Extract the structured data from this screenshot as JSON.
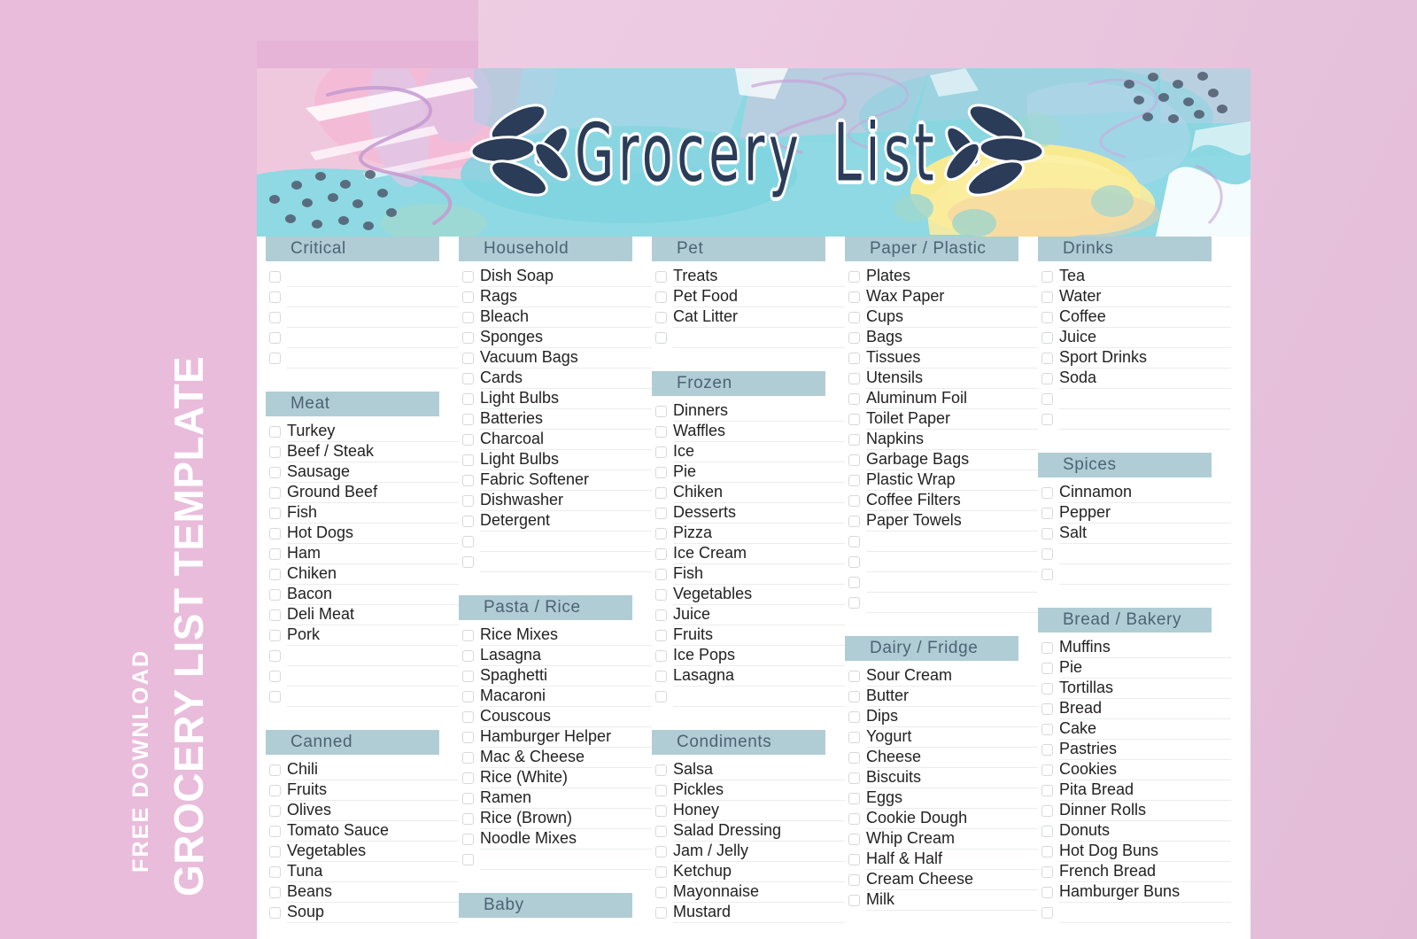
{
  "sidebar": {
    "title": "GROCERY LIST TEMPLATE",
    "subtitle": "FREE DOWNLOAD"
  },
  "banner": {
    "title_words": [
      "Grocery",
      "List"
    ],
    "title": "GROCERY LIST",
    "leaf_icon_left": "leaf-sprig-icon",
    "leaf_icon_right": "leaf-sprig-icon"
  },
  "colors": {
    "section_header_bg": "#b0cdd5",
    "section_header_text": "#4d6274",
    "page_bg_pink": "#e9c4dd",
    "sidebar_pink": "#e5b4d7",
    "banner_teal": "#8ed9e3",
    "banner_pink": "#f6c9de",
    "banner_yellow": "#f7e98f",
    "banner_navy": "#2b3c58",
    "item_rule": "#ebecee",
    "checkbox_border": "#d6d8da"
  },
  "columns": [
    {
      "name": "column-1",
      "sections": [
        {
          "title": "Critical",
          "items": [],
          "blank_rows": 5
        },
        {
          "title": "Meat",
          "items": [
            "Turkey",
            "Beef / Steak",
            "Sausage",
            "Ground Beef",
            "Fish",
            "Hot Dogs",
            "Ham",
            "Chiken",
            "Bacon",
            "Deli Meat",
            "Pork"
          ],
          "blank_rows": 3
        },
        {
          "title": "Canned",
          "items": [
            "Chili",
            "Fruits",
            "Olives",
            "Tomato Sauce",
            "Vegetables",
            "Tuna",
            "Beans",
            "Soup"
          ],
          "blank_rows": 0
        }
      ]
    },
    {
      "name": "column-2",
      "sections": [
        {
          "title": "Household",
          "items": [
            "Dish Soap",
            "Rags",
            "Bleach",
            "Sponges",
            "Vacuum Bags",
            "Cards",
            "Light Bulbs",
            "Batteries",
            "Charcoal",
            "Light Bulbs",
            "Fabric Softener",
            "Dishwasher",
            "Detergent"
          ],
          "blank_rows": 2
        },
        {
          "title": "Pasta / Rice",
          "items": [
            "Rice Mixes",
            "Lasagna",
            "Spaghetti",
            "Macaroni",
            "Couscous",
            "Hamburger Helper",
            "Mac & Cheese",
            "Rice (White)",
            "Ramen",
            "Rice (Brown)",
            "Noodle Mixes"
          ],
          "blank_rows": 1
        },
        {
          "title": "Baby",
          "items": [],
          "blank_rows": 0
        }
      ]
    },
    {
      "name": "column-3",
      "sections": [
        {
          "title": "Pet",
          "items": [
            "Treats",
            "Pet Food",
            "Cat Litter"
          ],
          "blank_rows": 1
        },
        {
          "title": "Frozen",
          "items": [
            "Dinners",
            "Waffles",
            "Ice",
            "Pie",
            "Chiken",
            "Desserts",
            "Pizza",
            "Ice Cream",
            "Fish",
            "Vegetables",
            "Juice",
            "Fruits",
            "Ice Pops",
            "Lasagna"
          ],
          "blank_rows": 1
        },
        {
          "title": "Condiments",
          "items": [
            "Salsa",
            "Pickles",
            "Honey",
            "Salad Dressing",
            "Jam / Jelly",
            "Ketchup",
            "Mayonnaise",
            "Mustard"
          ],
          "blank_rows": 0
        }
      ]
    },
    {
      "name": "column-4",
      "sections": [
        {
          "title": "Paper / Plastic",
          "items": [
            "Plates",
            "Wax Paper",
            "Cups",
            "Bags",
            "Tissues",
            "Utensils",
            "Aluminum Foil",
            "Toilet Paper",
            "Napkins",
            "Garbage Bags",
            "Plastic Wrap",
            "Coffee Filters",
            "Paper Towels"
          ],
          "blank_rows": 4
        },
        {
          "title": "Dairy / Fridge",
          "items": [
            "Sour Cream",
            "Butter",
            "Dips",
            "Yogurt",
            "Cheese",
            "Biscuits",
            "Eggs",
            "Cookie Dough",
            "Whip Cream",
            "Half & Half",
            "Cream Cheese",
            "Milk"
          ],
          "blank_rows": 0
        }
      ]
    },
    {
      "name": "column-5",
      "sections": [
        {
          "title": "Drinks",
          "items": [
            "Tea",
            "Water",
            "Coffee",
            "Juice",
            "Sport Drinks",
            "Soda"
          ],
          "blank_rows": 2
        },
        {
          "title": "Spices",
          "items": [
            "Cinnamon",
            "Pepper",
            "Salt"
          ],
          "blank_rows": 2
        },
        {
          "title": "Bread / Bakery",
          "items": [
            "Muffins",
            "Pie",
            "Tortillas",
            "Bread",
            "Cake",
            "Pastries",
            "Cookies",
            "Pita Bread",
            "Dinner Rolls",
            "Donuts",
            "Hot Dog Buns",
            "French Bread",
            "Hamburger Buns"
          ],
          "blank_rows": 1
        }
      ]
    }
  ]
}
